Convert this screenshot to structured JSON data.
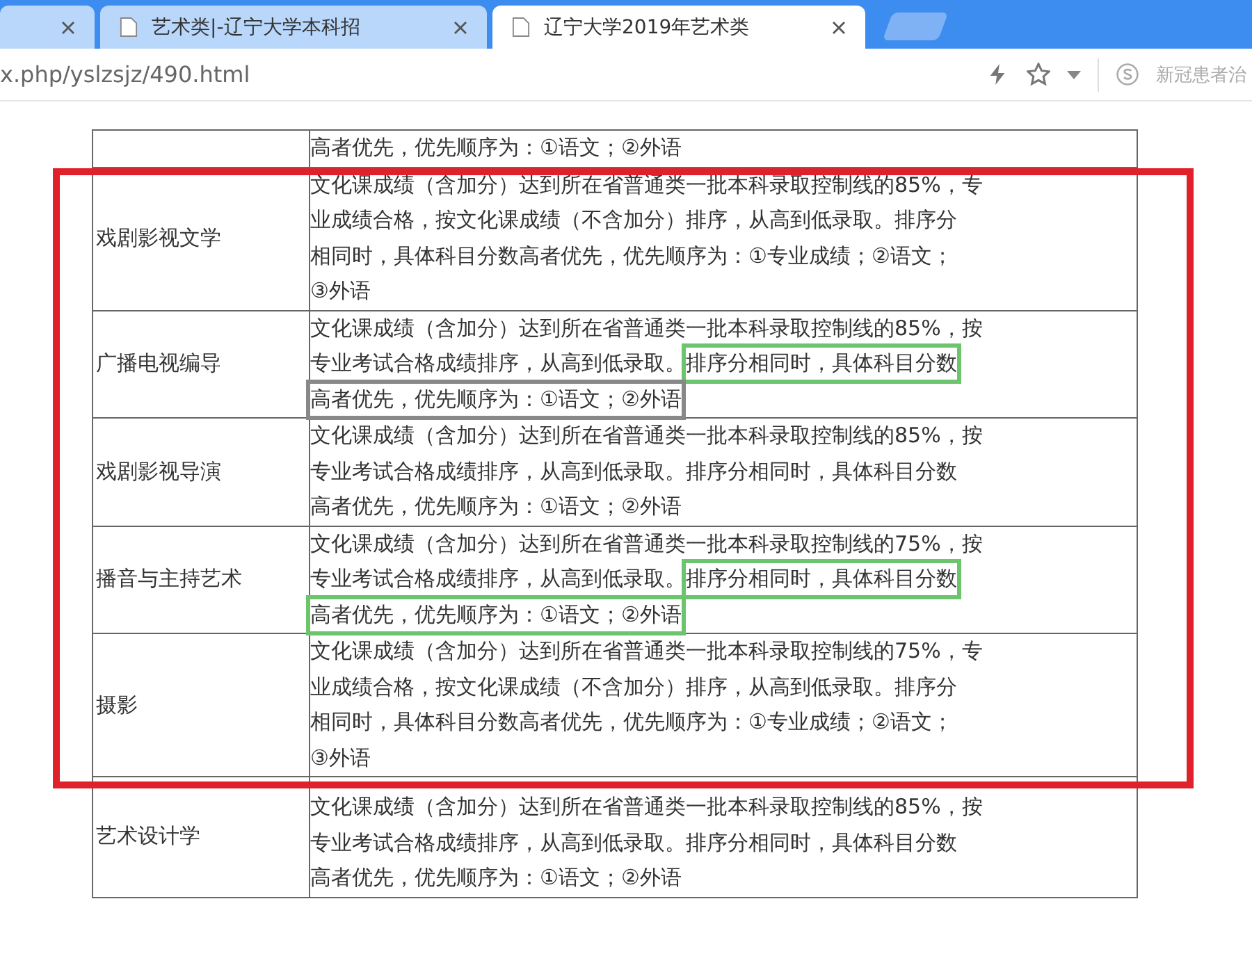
{
  "tabs": [
    {
      "selected": false
    },
    {
      "title": "艺术类|-辽宁大学本科招",
      "selected": false
    },
    {
      "title": "辽宁大学2019年艺术类",
      "selected": true
    }
  ],
  "address_bar": {
    "url": "x.php/yslzsjz/490.html"
  },
  "toolbar": {
    "news_text": "新冠患者治"
  },
  "table": {
    "rows": [
      {
        "lines": [
          [
            {
              "text": "高者优先，优先顺序为：①语文；②外语",
              "boxed": false
            }
          ]
        ]
      },
      {
        "major": "戏剧影视文学",
        "lines": [
          [
            {
              "text": "文化课成绩（含加分）达到所在省普通类一批本科录取控制线的85%，专",
              "boxed": false
            }
          ],
          [
            {
              "text": "业成绩合格，按文化课成绩（不含加分）排序，从高到低录取。排序分",
              "boxed": false
            }
          ],
          [
            {
              "text": "相同时，具体科目分数高者优先，优先顺序为：①专业成绩；②语文；",
              "boxed": false
            }
          ],
          [
            {
              "text": "③外语",
              "boxed": false
            }
          ]
        ]
      },
      {
        "major": "广播电视编导",
        "lines": [
          [
            {
              "text": "文化课成绩（含加分）达到所在省普通类一批本科录取控制线的85%，按",
              "boxed": false
            }
          ],
          [
            {
              "text": "专业考试合格成绩排序，从高到低录取。",
              "boxed": false
            },
            {
              "text": "排序分相同时，具体科目分数",
              "boxed": true,
              "color": "#6cc46c"
            }
          ],
          [
            {
              "text": "高者优先，优先顺序为：①语文；②外语",
              "boxed": true,
              "color": "#888888"
            }
          ]
        ]
      },
      {
        "major": "戏剧影视导演",
        "lines": [
          [
            {
              "text": "文化课成绩（含加分）达到所在省普通类一批本科录取控制线的85%，按",
              "boxed": false
            }
          ],
          [
            {
              "text": "专业考试合格成绩排序，从高到低录取。排序分相同时，具体科目分数",
              "boxed": false
            }
          ],
          [
            {
              "text": "高者优先，优先顺序为：①语文；②外语",
              "boxed": false
            }
          ]
        ]
      },
      {
        "major": "播音与主持艺术",
        "lines": [
          [
            {
              "text": "文化课成绩（含加分）达到所在省普通类一批本科录取控制线的75%，按",
              "boxed": false
            }
          ],
          [
            {
              "text": "专业考试合格成绩排序，从高到低录取。",
              "boxed": false
            },
            {
              "text": "排序分相同时，具体科目分数",
              "boxed": true,
              "color": "#6cc46c"
            }
          ],
          [
            {
              "text": "高者优先，优先顺序为：①语文；②外语",
              "boxed": true,
              "color": "#6cc46c"
            }
          ]
        ]
      },
      {
        "major": "摄影",
        "lines": [
          [
            {
              "text": "文化课成绩（含加分）达到所在省普通类一批本科录取控制线的75%，专",
              "boxed": false
            }
          ],
          [
            {
              "text": "业成绩合格，按文化课成绩（不含加分）排序，从高到低录取。排序分",
              "boxed": false
            }
          ],
          [
            {
              "text": "相同时，具体科目分数高者优先，优先顺序为：①专业成绩；②语文；",
              "boxed": false
            }
          ],
          [
            {
              "text": "③外语",
              "boxed": false
            }
          ]
        ]
      },
      {
        "major": "艺术设计学",
        "lines": [
          [
            {
              "text": "文化课成绩（含加分）达到所在省普通类一批本科录取控制线的85%，按",
              "boxed": false
            }
          ],
          [
            {
              "text": "专业考试合格成绩排序，从高到低录取。排序分相同时，具体科目分数",
              "boxed": false
            }
          ],
          [
            {
              "text": "高者优先，优先顺序为：①语文；②外语",
              "boxed": false
            }
          ]
        ]
      }
    ]
  }
}
